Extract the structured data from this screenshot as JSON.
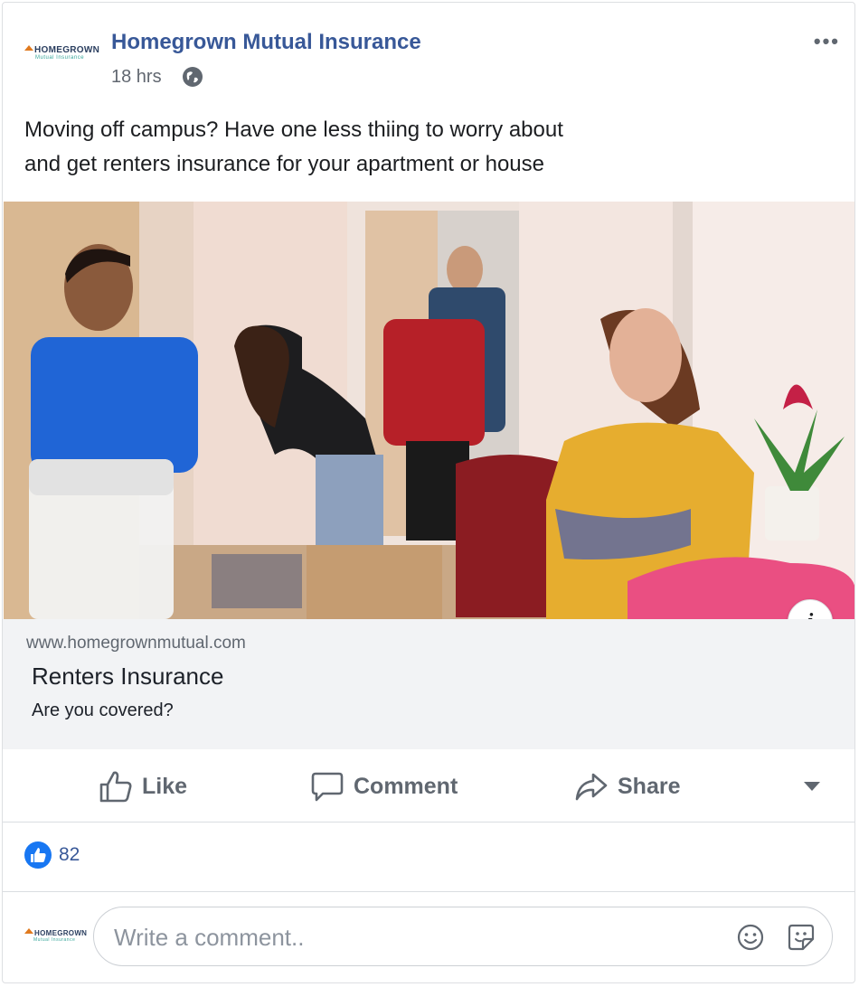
{
  "post": {
    "page_name": "Homegrown Mutual Insurance",
    "time": "18 hrs",
    "privacy_icon": "globe-icon",
    "text_line1": "Moving off campus?  Have one less thiing to worry about",
    "text_line2": "and get renters insurance for your apartment or house"
  },
  "logo": {
    "main": "HOMEGROWN",
    "sub": "Mutual Insurance"
  },
  "link_preview": {
    "url": "www.homegrownmutual.com",
    "title": "Renters Insurance",
    "description": "Are you covered?"
  },
  "actions": {
    "like": "Like",
    "comment": "Comment",
    "share": "Share"
  },
  "reactions": {
    "count": "82"
  },
  "comment_box": {
    "placeholder": "Write a comment.."
  },
  "colors": {
    "page_name": "#385898",
    "like_blue": "#1877f2",
    "action_gray": "#606770",
    "link_bg": "#f2f3f5"
  }
}
